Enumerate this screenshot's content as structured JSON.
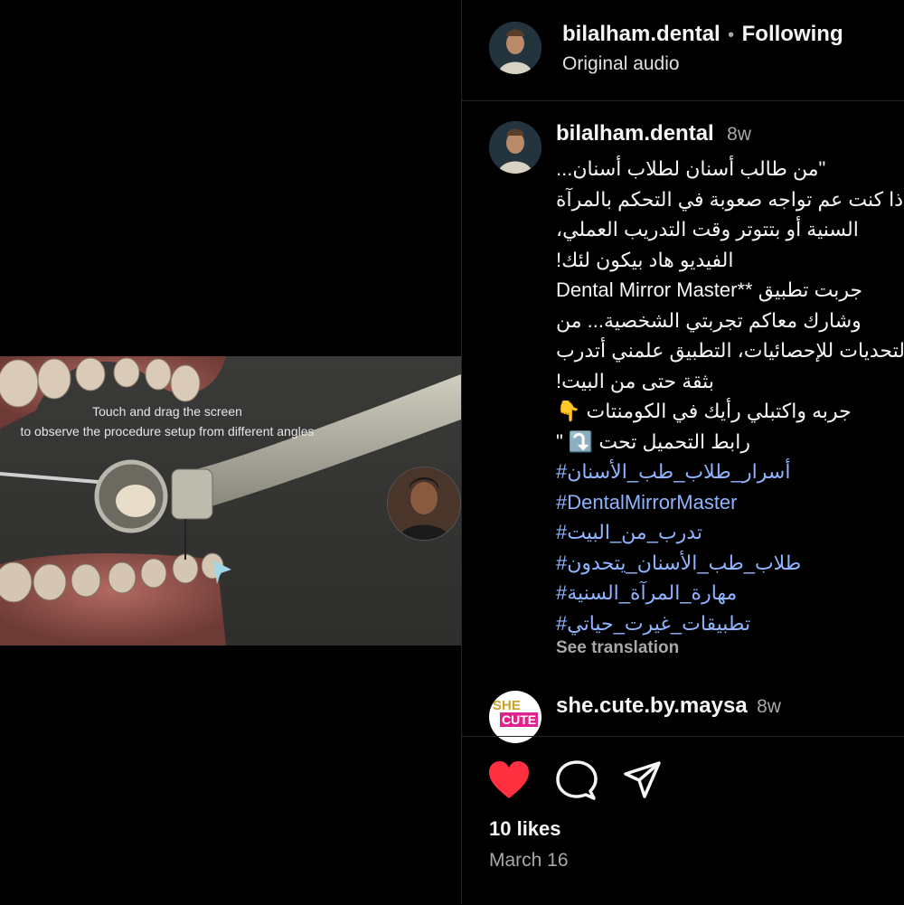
{
  "video": {
    "overlay_line1": "Touch and drag the screen",
    "overlay_line2": "to observe the procedure setup from different angles"
  },
  "header": {
    "username": "bilalham.dental",
    "separator": "•",
    "follow_label": "Following",
    "audio_label": "Original audio"
  },
  "post": {
    "username": "bilalham.dental",
    "age": "8w",
    "caption_lines": [
      "\"من طالب أسنان لطلاب أسنان...",
      "إذا كنت عم تواجه صعوبة في التحكم بالمرآة",
      "السنية أو بتتوتر وقت التدريب العملي،",
      "الفيديو هاد بيكون لئك!",
      "جربت تطبيق **Dental Mirror Master",
      "وشارك معاكم تجربتي الشخصية... من",
      "التحديات للإحصائيات، التطبيق علمني أتدرب",
      "بثقة حتى من البيت!",
      "جربه واكتبلي رأيك في الكومنتات 👇",
      "رابط التحميل تحت ⤵️ \""
    ],
    "hashtags": [
      "#أسرار_طلاب_طب_الأسنان",
      "#DentalMirrorMaster",
      "#تدرب_من_البيت",
      "#طلاب_طب_الأسنان_يتحدون",
      "#مهارة_المرآة_السنية",
      "#تطبيقات_غيرت_حياتي"
    ],
    "see_translation": "See translation"
  },
  "comment": {
    "username": "she.cute.by.maysa",
    "age": "8w",
    "avatar_text_1": "SHE",
    "avatar_text_2": "CUTE"
  },
  "footer": {
    "likes": "10 likes",
    "date": "March 16"
  },
  "colors": {
    "background": "#000000",
    "hashtag": "#8fb4ff",
    "heart": "#ff3040",
    "divider": "#262626"
  }
}
